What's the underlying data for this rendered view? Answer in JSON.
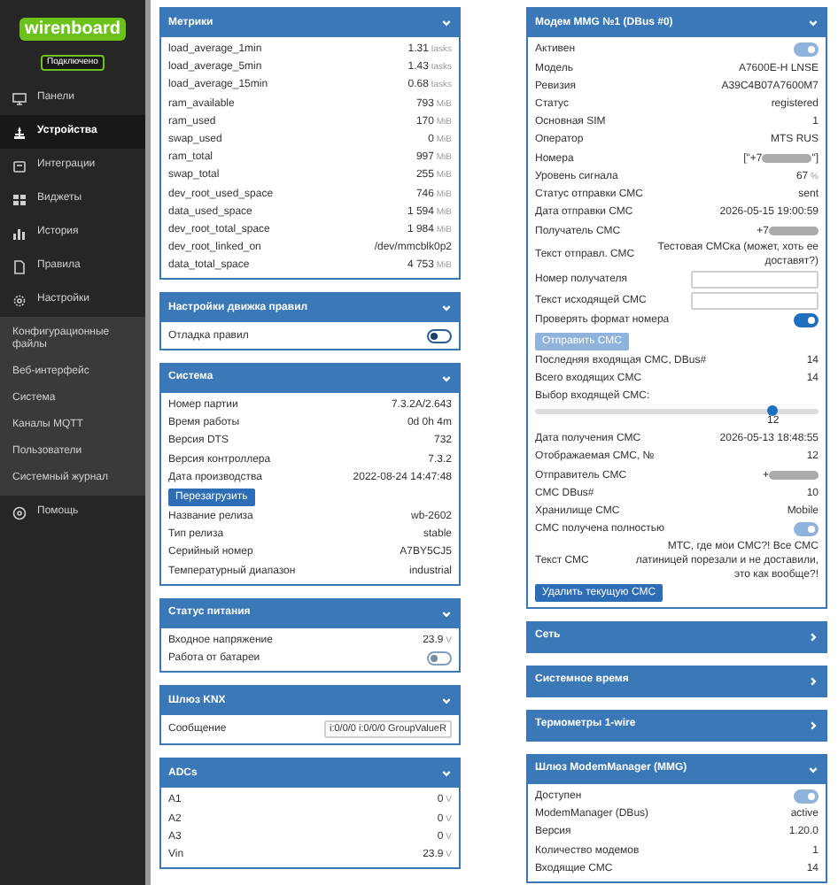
{
  "sidebar": {
    "logo": "wirenboard",
    "status": "Подключено",
    "items": [
      {
        "label": "Панели",
        "selected": false
      },
      {
        "label": "Устройства",
        "selected": true
      },
      {
        "label": "Интеграции",
        "selected": false
      },
      {
        "label": "Виджеты",
        "selected": false
      },
      {
        "label": "История",
        "selected": false
      },
      {
        "label": "Правила",
        "selected": false
      },
      {
        "label": "Настройки",
        "selected": false,
        "children": [
          {
            "label": "Конфигурационные файлы"
          },
          {
            "label": "Веб-интерфейс"
          },
          {
            "label": "Система"
          },
          {
            "label": "Каналы MQTT"
          },
          {
            "label": "Пользователи"
          },
          {
            "label": "Системный журнал"
          }
        ]
      },
      {
        "label": "Помощь",
        "selected": false
      }
    ]
  },
  "columns": [
    [
      {
        "title": "Метрики",
        "expanded": true,
        "rows": [
          {
            "kind": "value",
            "label": "load_average_1min",
            "value": "1.31",
            "unit": "tasks"
          },
          {
            "kind": "value",
            "label": "load_average_5min",
            "value": "1.43",
            "unit": "tasks"
          },
          {
            "kind": "value",
            "label": "load_average_15min",
            "value": "0.68",
            "unit": "tasks"
          },
          {
            "kind": "value",
            "label": "ram_available",
            "value": "793",
            "unit": "MiB"
          },
          {
            "kind": "value",
            "label": "ram_used",
            "value": "170",
            "unit": "MiB"
          },
          {
            "kind": "value",
            "label": "swap_used",
            "value": "0",
            "unit": "MiB"
          },
          {
            "kind": "value",
            "label": "ram_total",
            "value": "997",
            "unit": "MiB"
          },
          {
            "kind": "value",
            "label": "swap_total",
            "value": "255",
            "unit": "MiB"
          },
          {
            "kind": "value",
            "label": "dev_root_used_space",
            "value": "746",
            "unit": "MiB"
          },
          {
            "kind": "value",
            "label": "data_used_space",
            "value": "1 594",
            "unit": "MiB"
          },
          {
            "kind": "value",
            "label": "dev_root_total_space",
            "value": "1 984",
            "unit": "MiB"
          },
          {
            "kind": "value",
            "label": "dev_root_linked_on",
            "value": "/dev/mmcblk0p2"
          },
          {
            "kind": "value",
            "label": "data_total_space",
            "value": "4 753",
            "unit": "MiB"
          }
        ]
      },
      {
        "title": "Настройки движка правил",
        "expanded": true,
        "rows": [
          {
            "kind": "toggle",
            "label": "Отладка правил",
            "on": false,
            "disabled": false
          }
        ]
      },
      {
        "title": "Система",
        "expanded": true,
        "rows": [
          {
            "kind": "value",
            "label": "Номер партии",
            "value": "7.3.2A/2.643"
          },
          {
            "kind": "value",
            "label": "Время работы",
            "value": "0d 0h 4m"
          },
          {
            "kind": "value",
            "label": "Версия DTS",
            "value": "732"
          },
          {
            "kind": "value",
            "label": "Версия контроллера",
            "value": "7.3.2"
          },
          {
            "kind": "value",
            "label": "Дата производства",
            "value": "2022-08-24 14:47:48"
          },
          {
            "kind": "button",
            "label": "Перезагрузить",
            "disabled": false
          },
          {
            "kind": "value",
            "label": "Название релиза",
            "value": "wb-2602"
          },
          {
            "kind": "value",
            "label": "Тип релиза",
            "value": "stable"
          },
          {
            "kind": "value",
            "label": "Серийный номер",
            "value": "A7BY5CJ5"
          },
          {
            "kind": "value",
            "label": "Температурный диапазон",
            "value": "industrial"
          }
        ]
      },
      {
        "title": "Статус питания",
        "expanded": true,
        "rows": [
          {
            "kind": "value",
            "label": "Входное напряжение",
            "value": "23.9",
            "unit": "V"
          },
          {
            "kind": "toggle",
            "label": "Работа от батареи",
            "on": false,
            "disabled": true
          }
        ]
      },
      {
        "title": "Шлюз KNX",
        "expanded": true,
        "rows": [
          {
            "kind": "input",
            "label": "Сообщение",
            "value": "i:0/0/0 i:0/0/0 GroupValueR"
          }
        ]
      },
      {
        "title": "ADCs",
        "expanded": true,
        "rows": [
          {
            "kind": "value",
            "label": "A1",
            "value": "0",
            "unit": "V"
          },
          {
            "kind": "value",
            "label": "A2",
            "value": "0",
            "unit": "V"
          },
          {
            "kind": "value",
            "label": "A3",
            "value": "0",
            "unit": "V"
          },
          {
            "kind": "value",
            "label": "Vin",
            "value": "23.9",
            "unit": "V"
          }
        ]
      }
    ],
    [
      {
        "title": "Модем MMG №1 (DBus #0)",
        "expanded": true,
        "rows": [
          {
            "kind": "toggle",
            "label": "Активен",
            "on": true,
            "disabled": true
          },
          {
            "kind": "value",
            "label": "Модель",
            "value": "A7600E-H LNSE"
          },
          {
            "kind": "value",
            "label": "Ревизия",
            "value": "A39C4B07A7600M7"
          },
          {
            "kind": "value",
            "label": "Статус",
            "value": "registered"
          },
          {
            "kind": "value",
            "label": "Основная SIM",
            "value": "1"
          },
          {
            "kind": "value",
            "label": "Оператор",
            "value": "MTS RUS"
          },
          {
            "kind": "masked",
            "label": "Номера",
            "prefix": "[\"+7",
            "suffix": "\"]"
          },
          {
            "kind": "value",
            "label": "Уровень сигнала",
            "value": "67",
            "unit": "%"
          },
          {
            "kind": "value",
            "label": "Статус отправки СМС",
            "value": "sent"
          },
          {
            "kind": "value",
            "label": "Дата отправки СМС",
            "value": "2026-05-15 19:00:59"
          },
          {
            "kind": "masked",
            "label": "Получатель СМС",
            "prefix": "+7"
          },
          {
            "kind": "value",
            "label": "Текст отправл. СМС",
            "value": "Тестовая СМСка (может, хоть ее доставят?)"
          },
          {
            "kind": "input",
            "label": "Номер получателя"
          },
          {
            "kind": "input",
            "label": "Текст исходящей СМС"
          },
          {
            "kind": "toggle",
            "label": "Проверять формат номера",
            "on": true,
            "disabled": false
          },
          {
            "kind": "button",
            "label": "Отправить СМС",
            "disabled": true
          },
          {
            "kind": "value",
            "label": "Последняя входящая СМС, DBus#",
            "value": "14"
          },
          {
            "kind": "value",
            "label": "Всего входящих СМС",
            "value": "14"
          },
          {
            "kind": "slider",
            "label": "Выбор входящей СМС:",
            "level": 0.84,
            "reading": "12"
          },
          {
            "kind": "value",
            "label": "Дата получения СМС",
            "value": "2026-05-13 18:48:55"
          },
          {
            "kind": "value",
            "label": "Отображаемая СМС, №",
            "value": "12"
          },
          {
            "kind": "masked",
            "label": "Отправитель СМС",
            "prefix": "+"
          },
          {
            "kind": "value",
            "label": "СМС DBus#",
            "value": "10"
          },
          {
            "kind": "value",
            "label": "Хранилище СМС",
            "value": "Mobile"
          },
          {
            "kind": "toggle",
            "label": "СМС получена полностью",
            "on": true,
            "disabled": true
          },
          {
            "kind": "value",
            "label": "Текст СМС",
            "value": "МТС, где мои СМС?! Все СМС латиницей порезали и не доставили, это как вообще?!"
          },
          {
            "kind": "button",
            "label": "Удалить текущую СМС",
            "disabled": false
          }
        ]
      },
      {
        "title": "Сеть",
        "expanded": false
      },
      {
        "title": "Системное время",
        "expanded": false
      },
      {
        "title": "Термометры 1-wire",
        "expanded": false
      },
      {
        "title": "Шлюз ModemManager (MMG)",
        "expanded": true,
        "rows": [
          {
            "kind": "toggle",
            "label": "Доступен",
            "on": true,
            "disabled": true
          },
          {
            "kind": "value",
            "label": "ModemManager (DBus)",
            "value": "active"
          },
          {
            "kind": "value",
            "label": "Версия",
            "value": "1.20.0"
          },
          {
            "kind": "value",
            "label": "Количество модемов",
            "value": "1"
          },
          {
            "kind": "value",
            "label": "Входящие СМС",
            "value": "14"
          }
        ]
      }
    ]
  ]
}
